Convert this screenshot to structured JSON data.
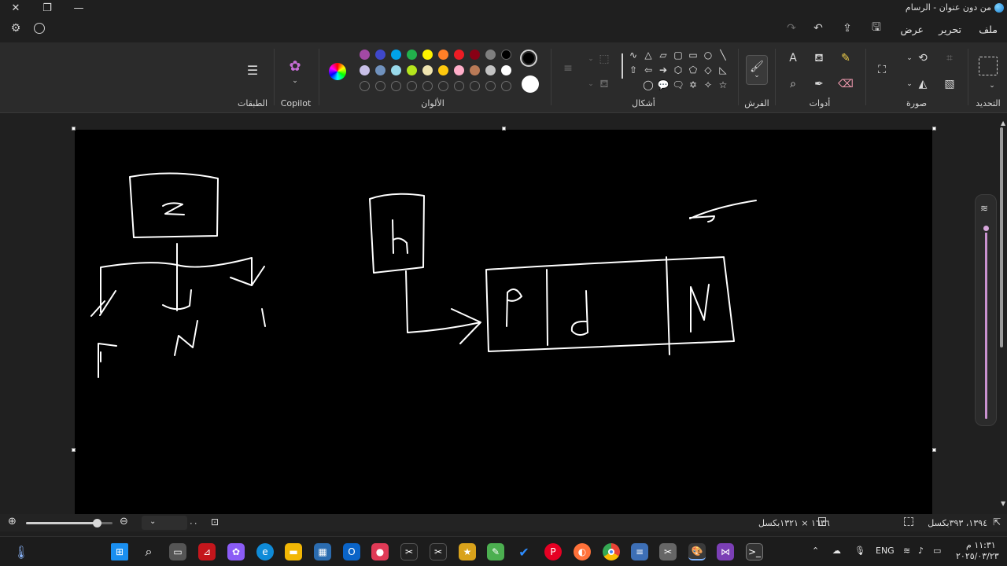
{
  "titlebar": {
    "title": "من دون عنوان - الرسام"
  },
  "menu": {
    "file": "ملف",
    "edit": "تحرير",
    "view": "عرض"
  },
  "ribbon": {
    "groups": {
      "selection": "التحديد",
      "image": "صورة",
      "tools": "أدوات",
      "brushes": "الفرش",
      "shapes": "أشكال",
      "colors": "الألوان",
      "copilot": "Copilot",
      "layers": "الطبقات"
    },
    "palette_row1": [
      "#000000",
      "#7f7f7f",
      "#880015",
      "#ed1c24",
      "#ff7f27",
      "#fff200",
      "#22b14c",
      "#00a2e8",
      "#3f48cc",
      "#a349a4"
    ],
    "palette_row2": [
      "#ffffff",
      "#c3c3c3",
      "#b97a57",
      "#ffaec9",
      "#ffc90e",
      "#efe4b0",
      "#b5e61d",
      "#99d9ea",
      "#7092be",
      "#c8bfe7"
    ],
    "primary_color": "#000000",
    "secondary_color": "#ffffff",
    "shape_glyphs": [
      "╲",
      "○",
      "▭",
      "▢",
      "▱",
      "△",
      "∿",
      "◺",
      "◇",
      "⬠",
      "⬡",
      "➔",
      "⇦",
      "⇧",
      "☆",
      "✧",
      "✡",
      "🗨",
      "💬",
      "◯"
    ]
  },
  "status": {
    "cursor_position": "١٣٩٤، ٣٩٣بكسل",
    "canvas_size": "١٦٣٦ × ١٣٢١بكسل",
    "zoom": "٪١٠٠"
  },
  "tray": {
    "language": "ENG",
    "time": "١١:٣١ م",
    "date": "٢٠٢٥/٠٣/٢٣"
  }
}
